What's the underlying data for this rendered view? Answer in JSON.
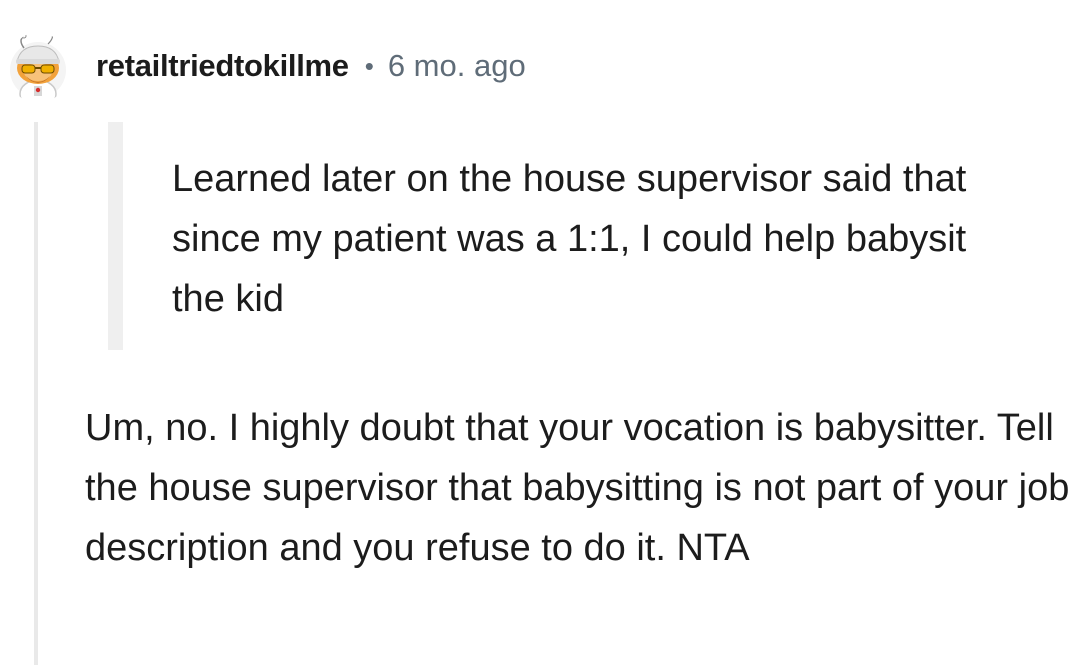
{
  "comment": {
    "author": "retailtriedtokillme",
    "separator": "•",
    "timestamp": "6 mo. ago",
    "avatar_icon": "snoo-avatar-icon",
    "quote": "Learned later on the house supervisor said that since my patient was a 1:1, I could help babysit the kid",
    "body": "Um, no. I highly doubt that your vocation is babysitter. Tell the house supervisor that babysitting is not part of your job description and you refuse to do it. NTA"
  },
  "colors": {
    "text": "#1c1c1c",
    "meta": "#5f6c78",
    "thread_line": "#e9e9e9",
    "quote_bar": "#efefef"
  }
}
